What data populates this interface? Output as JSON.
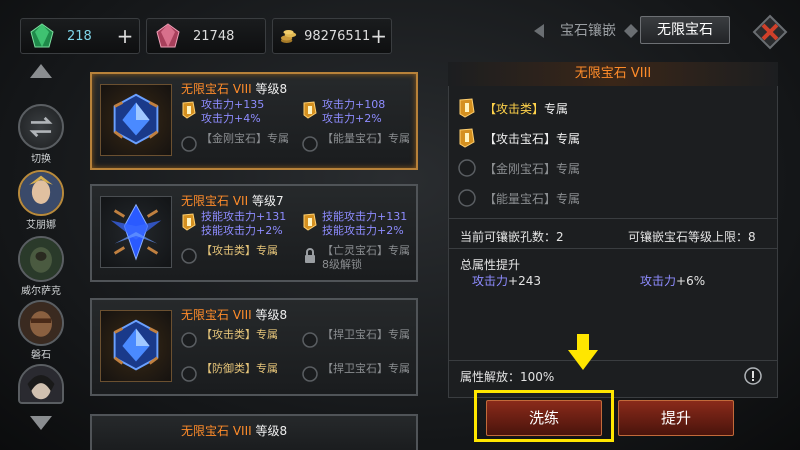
{
  "currencies": [
    {
      "name": "emerald",
      "value": "218",
      "color": "#2fa860"
    },
    {
      "name": "ruby",
      "value": "21748",
      "color": "#d1587a"
    },
    {
      "name": "gold-coins",
      "value": "98276511",
      "color": "#c9a048"
    }
  ],
  "tabs": {
    "inlay": "宝石镶嵌",
    "infinite": "无限宝石"
  },
  "heroes": {
    "switch_label": "切换",
    "list": [
      "艾朋娜",
      "威尔萨克",
      "磐石"
    ]
  },
  "gems": [
    {
      "title_name": "无限宝石 VIII",
      "title_level": "等级8",
      "slots": [
        {
          "lines": [
            "攻击力+135",
            "攻击力+4%"
          ],
          "style": "purple",
          "icon": "orange"
        },
        {
          "lines": [
            "攻击力+108",
            "攻击力+2%"
          ],
          "style": "purple",
          "icon": "orange"
        },
        {
          "lines": [
            "【金刚宝石】专属"
          ],
          "style": "gray",
          "icon": "empty"
        },
        {
          "lines": [
            "【能量宝石】专属"
          ],
          "style": "gray",
          "icon": "empty"
        }
      ]
    },
    {
      "title_name": "无限宝石 VII",
      "title_level": "等级7",
      "slots": [
        {
          "lines": [
            "技能攻击力+131",
            "技能攻击力+2%"
          ],
          "style": "purple",
          "icon": "orange"
        },
        {
          "lines": [
            "技能攻击力+131",
            "技能攻击力+2%"
          ],
          "style": "purple",
          "icon": "orange"
        },
        {
          "lines": [
            "【攻击类】专属"
          ],
          "style": "gold",
          "icon": "empty"
        },
        {
          "lines": [
            "【亡灵宝石】专属",
            "8级解锁"
          ],
          "style": "gray",
          "icon": "lock"
        }
      ]
    },
    {
      "title_name": "无限宝石 VIII",
      "title_level": "等级8",
      "slots": [
        {
          "lines": [
            "【攻击类】专属"
          ],
          "style": "gold",
          "icon": "empty"
        },
        {
          "lines": [
            "【捍卫宝石】专属"
          ],
          "style": "gray",
          "icon": "empty"
        },
        {
          "lines": [
            "【防御类】专属"
          ],
          "style": "gold",
          "icon": "empty"
        },
        {
          "lines": [
            "【捍卫宝石】专属"
          ],
          "style": "gray",
          "icon": "empty"
        }
      ]
    },
    {
      "title_name": "无限宝石 VIII",
      "title_level": "等级8"
    }
  ],
  "detail": {
    "title": "无限宝石 VIII",
    "requirements": [
      {
        "bracket": "【攻击类】",
        "suffix": "专属",
        "active": true
      },
      {
        "bracket": "【攻击宝石】",
        "suffix": "专属",
        "active": true
      },
      {
        "bracket": "【金刚宝石】",
        "suffix": "专属",
        "active": false
      },
      {
        "bracket": "【能量宝石】",
        "suffix": "专属",
        "active": false
      }
    ],
    "slots_label": "当前可镶嵌孔数：2",
    "level_cap_label": "可镶嵌宝石等级上限：8",
    "total_label": "总属性提升",
    "stat1_name": "攻击力",
    "stat1_value": "+243",
    "stat2_name": "攻击力",
    "stat2_value": "+6%",
    "release_label": "属性解放：100%",
    "refine_button": "洗练",
    "upgrade_button": "提升"
  }
}
